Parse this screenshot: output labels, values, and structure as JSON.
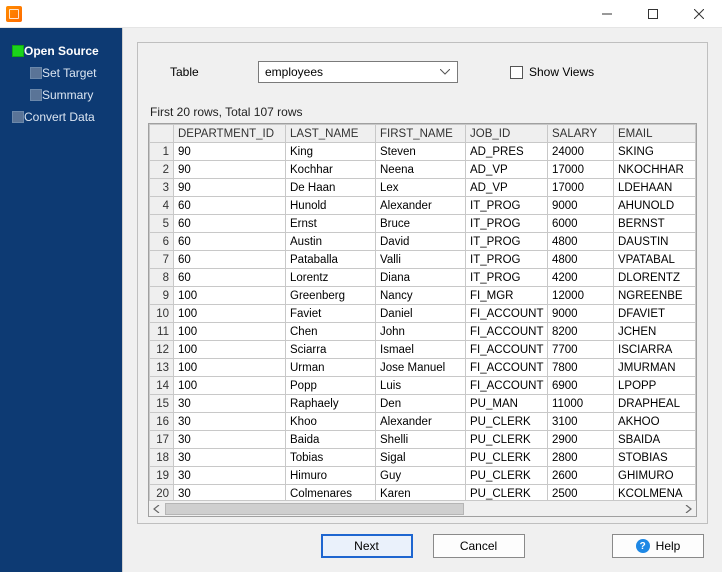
{
  "window": {
    "title": ""
  },
  "sidebar": {
    "items": [
      {
        "id": "open-source",
        "label": "Open Source",
        "active": true,
        "level": 0
      },
      {
        "id": "set-target",
        "label": "Set Target",
        "active": false,
        "level": 1
      },
      {
        "id": "summary",
        "label": "Summary",
        "active": false,
        "level": 1
      },
      {
        "id": "convert-data",
        "label": "Convert Data",
        "active": false,
        "level": 0
      }
    ]
  },
  "controls": {
    "table_label": "Table",
    "table_selected": "employees",
    "show_views_label": "Show Views",
    "show_views_checked": false
  },
  "caption": "First 20 rows, Total 107 rows",
  "grid": {
    "columns": [
      "DEPARTMENT_ID",
      "LAST_NAME",
      "FIRST_NAME",
      "JOB_ID",
      "SALARY",
      "EMAIL"
    ],
    "rows": [
      {
        "n": 1,
        "DEPARTMENT_ID": "90",
        "LAST_NAME": "King",
        "FIRST_NAME": "Steven",
        "JOB_ID": "AD_PRES",
        "SALARY": "24000",
        "EMAIL": "SKING"
      },
      {
        "n": 2,
        "DEPARTMENT_ID": "90",
        "LAST_NAME": "Kochhar",
        "FIRST_NAME": "Neena",
        "JOB_ID": "AD_VP",
        "SALARY": "17000",
        "EMAIL": "NKOCHHAR"
      },
      {
        "n": 3,
        "DEPARTMENT_ID": "90",
        "LAST_NAME": "De Haan",
        "FIRST_NAME": "Lex",
        "JOB_ID": "AD_VP",
        "SALARY": "17000",
        "EMAIL": "LDEHAAN"
      },
      {
        "n": 4,
        "DEPARTMENT_ID": "60",
        "LAST_NAME": "Hunold",
        "FIRST_NAME": "Alexander",
        "JOB_ID": "IT_PROG",
        "SALARY": "9000",
        "EMAIL": "AHUNOLD"
      },
      {
        "n": 5,
        "DEPARTMENT_ID": "60",
        "LAST_NAME": "Ernst",
        "FIRST_NAME": "Bruce",
        "JOB_ID": "IT_PROG",
        "SALARY": "6000",
        "EMAIL": "BERNST"
      },
      {
        "n": 6,
        "DEPARTMENT_ID": "60",
        "LAST_NAME": "Austin",
        "FIRST_NAME": "David",
        "JOB_ID": "IT_PROG",
        "SALARY": "4800",
        "EMAIL": "DAUSTIN"
      },
      {
        "n": 7,
        "DEPARTMENT_ID": "60",
        "LAST_NAME": "Pataballa",
        "FIRST_NAME": "Valli",
        "JOB_ID": "IT_PROG",
        "SALARY": "4800",
        "EMAIL": "VPATABAL"
      },
      {
        "n": 8,
        "DEPARTMENT_ID": "60",
        "LAST_NAME": "Lorentz",
        "FIRST_NAME": "Diana",
        "JOB_ID": "IT_PROG",
        "SALARY": "4200",
        "EMAIL": "DLORENTZ"
      },
      {
        "n": 9,
        "DEPARTMENT_ID": "100",
        "LAST_NAME": "Greenberg",
        "FIRST_NAME": "Nancy",
        "JOB_ID": "FI_MGR",
        "SALARY": "12000",
        "EMAIL": "NGREENBE"
      },
      {
        "n": 10,
        "DEPARTMENT_ID": "100",
        "LAST_NAME": "Faviet",
        "FIRST_NAME": "Daniel",
        "JOB_ID": "FI_ACCOUNT",
        "SALARY": "9000",
        "EMAIL": "DFAVIET"
      },
      {
        "n": 11,
        "DEPARTMENT_ID": "100",
        "LAST_NAME": "Chen",
        "FIRST_NAME": "John",
        "JOB_ID": "FI_ACCOUNT",
        "SALARY": "8200",
        "EMAIL": "JCHEN"
      },
      {
        "n": 12,
        "DEPARTMENT_ID": "100",
        "LAST_NAME": "Sciarra",
        "FIRST_NAME": "Ismael",
        "JOB_ID": "FI_ACCOUNT",
        "SALARY": "7700",
        "EMAIL": "ISCIARRA"
      },
      {
        "n": 13,
        "DEPARTMENT_ID": "100",
        "LAST_NAME": "Urman",
        "FIRST_NAME": "Jose Manuel",
        "JOB_ID": "FI_ACCOUNT",
        "SALARY": "7800",
        "EMAIL": "JMURMAN"
      },
      {
        "n": 14,
        "DEPARTMENT_ID": "100",
        "LAST_NAME": "Popp",
        "FIRST_NAME": "Luis",
        "JOB_ID": "FI_ACCOUNT",
        "SALARY": "6900",
        "EMAIL": "LPOPP"
      },
      {
        "n": 15,
        "DEPARTMENT_ID": "30",
        "LAST_NAME": "Raphaely",
        "FIRST_NAME": "Den",
        "JOB_ID": "PU_MAN",
        "SALARY": "11000",
        "EMAIL": "DRAPHEAL"
      },
      {
        "n": 16,
        "DEPARTMENT_ID": "30",
        "LAST_NAME": "Khoo",
        "FIRST_NAME": "Alexander",
        "JOB_ID": "PU_CLERK",
        "SALARY": "3100",
        "EMAIL": "AKHOO"
      },
      {
        "n": 17,
        "DEPARTMENT_ID": "30",
        "LAST_NAME": "Baida",
        "FIRST_NAME": "Shelli",
        "JOB_ID": "PU_CLERK",
        "SALARY": "2900",
        "EMAIL": "SBAIDA"
      },
      {
        "n": 18,
        "DEPARTMENT_ID": "30",
        "LAST_NAME": "Tobias",
        "FIRST_NAME": "Sigal",
        "JOB_ID": "PU_CLERK",
        "SALARY": "2800",
        "EMAIL": "STOBIAS"
      },
      {
        "n": 19,
        "DEPARTMENT_ID": "30",
        "LAST_NAME": "Himuro",
        "FIRST_NAME": "Guy",
        "JOB_ID": "PU_CLERK",
        "SALARY": "2600",
        "EMAIL": "GHIMURO"
      },
      {
        "n": 20,
        "DEPARTMENT_ID": "30",
        "LAST_NAME": "Colmenares",
        "FIRST_NAME": "Karen",
        "JOB_ID": "PU_CLERK",
        "SALARY": "2500",
        "EMAIL": "KCOLMENA"
      }
    ]
  },
  "footer": {
    "next": "Next",
    "cancel": "Cancel",
    "help": "Help"
  }
}
